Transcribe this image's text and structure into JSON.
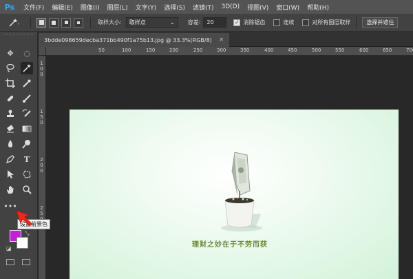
{
  "app": {
    "logo": "Ps"
  },
  "menu": [
    "文件(F)",
    "编辑(E)",
    "图像(I)",
    "图层(L)",
    "文字(Y)",
    "选择(S)",
    "滤镜(T)",
    "3D(D)",
    "视图(V)",
    "窗口(W)",
    "帮助(H)"
  ],
  "options": {
    "sample_size_label": "取样大小:",
    "sample_size_value": "取样点",
    "tolerance_label": "容差:",
    "tolerance_value": "20",
    "antialias_label": "消除锯齿",
    "contiguous_label": "连续",
    "all_layers_label": "对所有图层取样",
    "select_mask_button": "选择并遮住"
  },
  "document": {
    "tab_title": "3bdde098659decba371bb490f1a75b13.jpg @ 33.3%(RGB/8)",
    "close_glyph": "×",
    "artwork_caption": "理财之妙在于不劳而获"
  },
  "ruler_top": [
    "50",
    "100",
    "150",
    "200",
    "250",
    "300",
    "350",
    "400",
    "450",
    "500",
    "550",
    "600",
    "650",
    "700"
  ],
  "ruler_left": [
    "1",
    "0",
    "0",
    "1",
    "5",
    "0",
    "2",
    "0",
    "0",
    "2",
    "5",
    "0"
  ],
  "colors": {
    "foreground": "#c41fd9",
    "background": "#ffffff",
    "accent": "#31a8ff",
    "pointer": "#e8291c"
  },
  "tooltip": "设置前景色",
  "tools": [
    "move-tool",
    "marquee-tool",
    "lasso-tool",
    "magic-wand-tool",
    "crop-tool",
    "eyedropper-tool",
    "healing-brush-tool",
    "brush-tool",
    "clone-stamp-tool",
    "history-brush-tool",
    "eraser-tool",
    "gradient-tool",
    "blur-tool",
    "dodge-tool",
    "pen-tool",
    "type-tool",
    "path-selection-tool",
    "shape-tool",
    "hand-tool",
    "zoom-tool",
    "more-tools"
  ]
}
